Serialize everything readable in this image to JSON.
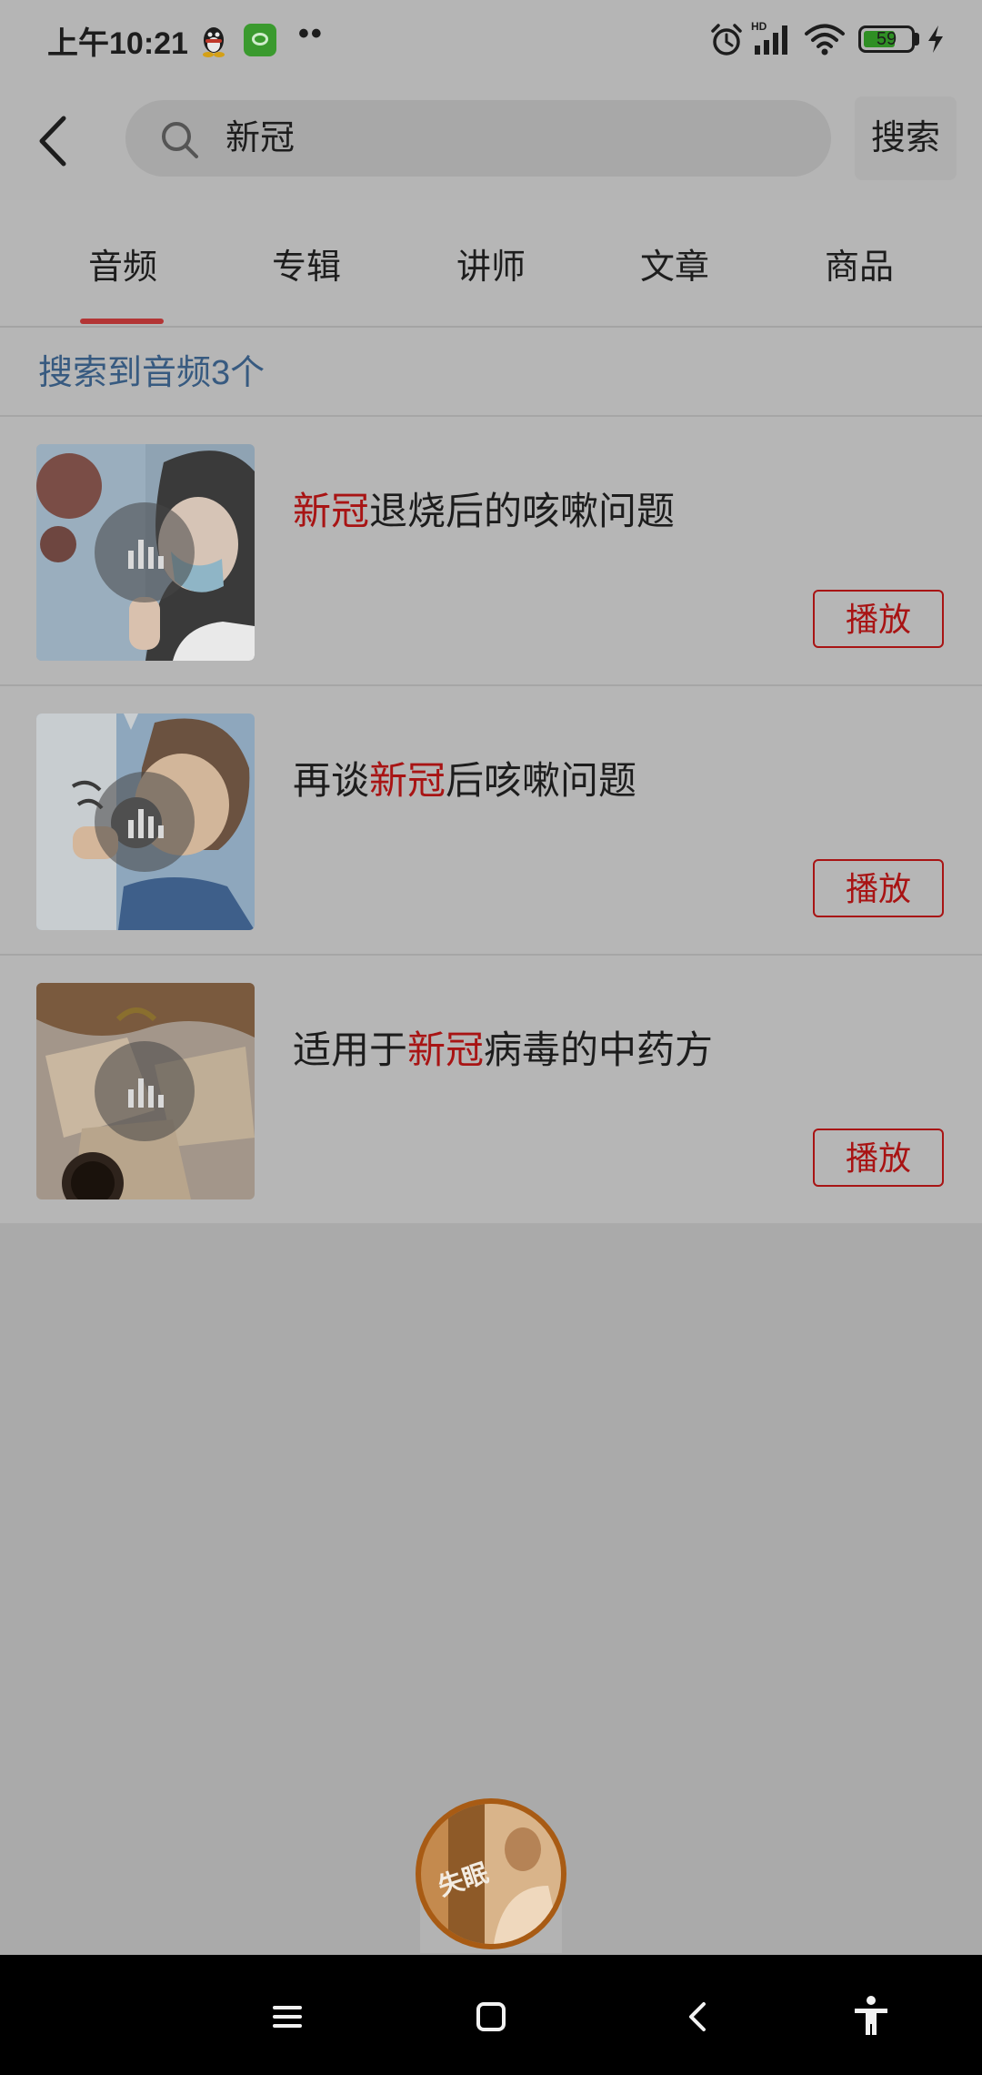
{
  "status_bar": {
    "time": "上午10:21",
    "dots": "••",
    "battery_level": "59"
  },
  "search": {
    "query": "新冠",
    "button_label": "搜索"
  },
  "tabs": [
    "音频",
    "专辑",
    "讲师",
    "文章",
    "商品"
  ],
  "active_tab_index": 0,
  "result_count_text": "搜索到音频3个",
  "results": [
    {
      "title_prefix": "",
      "title_highlight": "新冠",
      "title_suffix": "退烧后的咳嗽问题",
      "play_label": "播放"
    },
    {
      "title_prefix": "再谈",
      "title_highlight": "新冠",
      "title_suffix": "后咳嗽问题",
      "play_label": "播放"
    },
    {
      "title_prefix": "适用于",
      "title_highlight": "新冠",
      "title_suffix": "病毒的中药方",
      "play_label": "播放"
    }
  ],
  "floating_player": {
    "label": "失眠"
  },
  "colors": {
    "highlight": "#a81414",
    "count_text": "#375a80",
    "tab_indicator": "#b33535"
  }
}
